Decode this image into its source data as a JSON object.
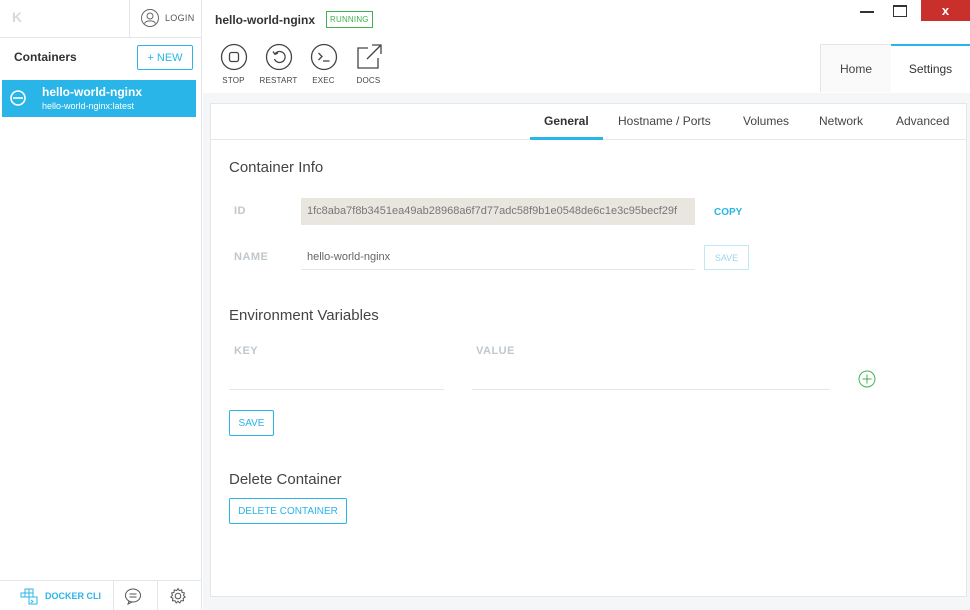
{
  "sidebar": {
    "logo": "K",
    "login_label": "LOGIN",
    "containers_title": "Containers",
    "new_button": "+ NEW",
    "containers": [
      {
        "name": "hello-world-nginx",
        "image": "hello-world-nginx:latest"
      }
    ],
    "bottom": {
      "docker_cli_label": "DOCKER CLI"
    }
  },
  "header": {
    "title": "hello-world-nginx",
    "status": "RUNNING",
    "window_close": "x",
    "toolbar": [
      {
        "label": "STOP",
        "icon": "stop-icon"
      },
      {
        "label": "RESTART",
        "icon": "restart-icon"
      },
      {
        "label": "EXEC",
        "icon": "terminal-icon"
      },
      {
        "label": "DOCS",
        "icon": "external-link-icon"
      }
    ],
    "tabs": [
      {
        "label": "Home",
        "active": false
      },
      {
        "label": "Settings",
        "active": true
      }
    ]
  },
  "settings": {
    "subtabs": [
      "General",
      "Hostname / Ports",
      "Volumes",
      "Network",
      "Advanced"
    ],
    "active_subtab": "General",
    "container_info": {
      "title": "Container Info",
      "id_label": "ID",
      "id_value": "1fc8aba7f8b3451ea49ab28968a6f7d77adc58f9b1e0548de6c1e3c95becf29f",
      "copy_label": "COPY",
      "name_label": "NAME",
      "name_value": "hello-world-nginx",
      "save_label": "SAVE"
    },
    "env": {
      "title": "Environment Variables",
      "key_label": "KEY",
      "value_label": "VALUE",
      "save_label": "SAVE"
    },
    "delete": {
      "title": "Delete Container",
      "button_label": "DELETE CONTAINER"
    }
  },
  "colors": {
    "accent": "#29b5e8",
    "running": "#3fb34f",
    "close": "#c9302c"
  }
}
